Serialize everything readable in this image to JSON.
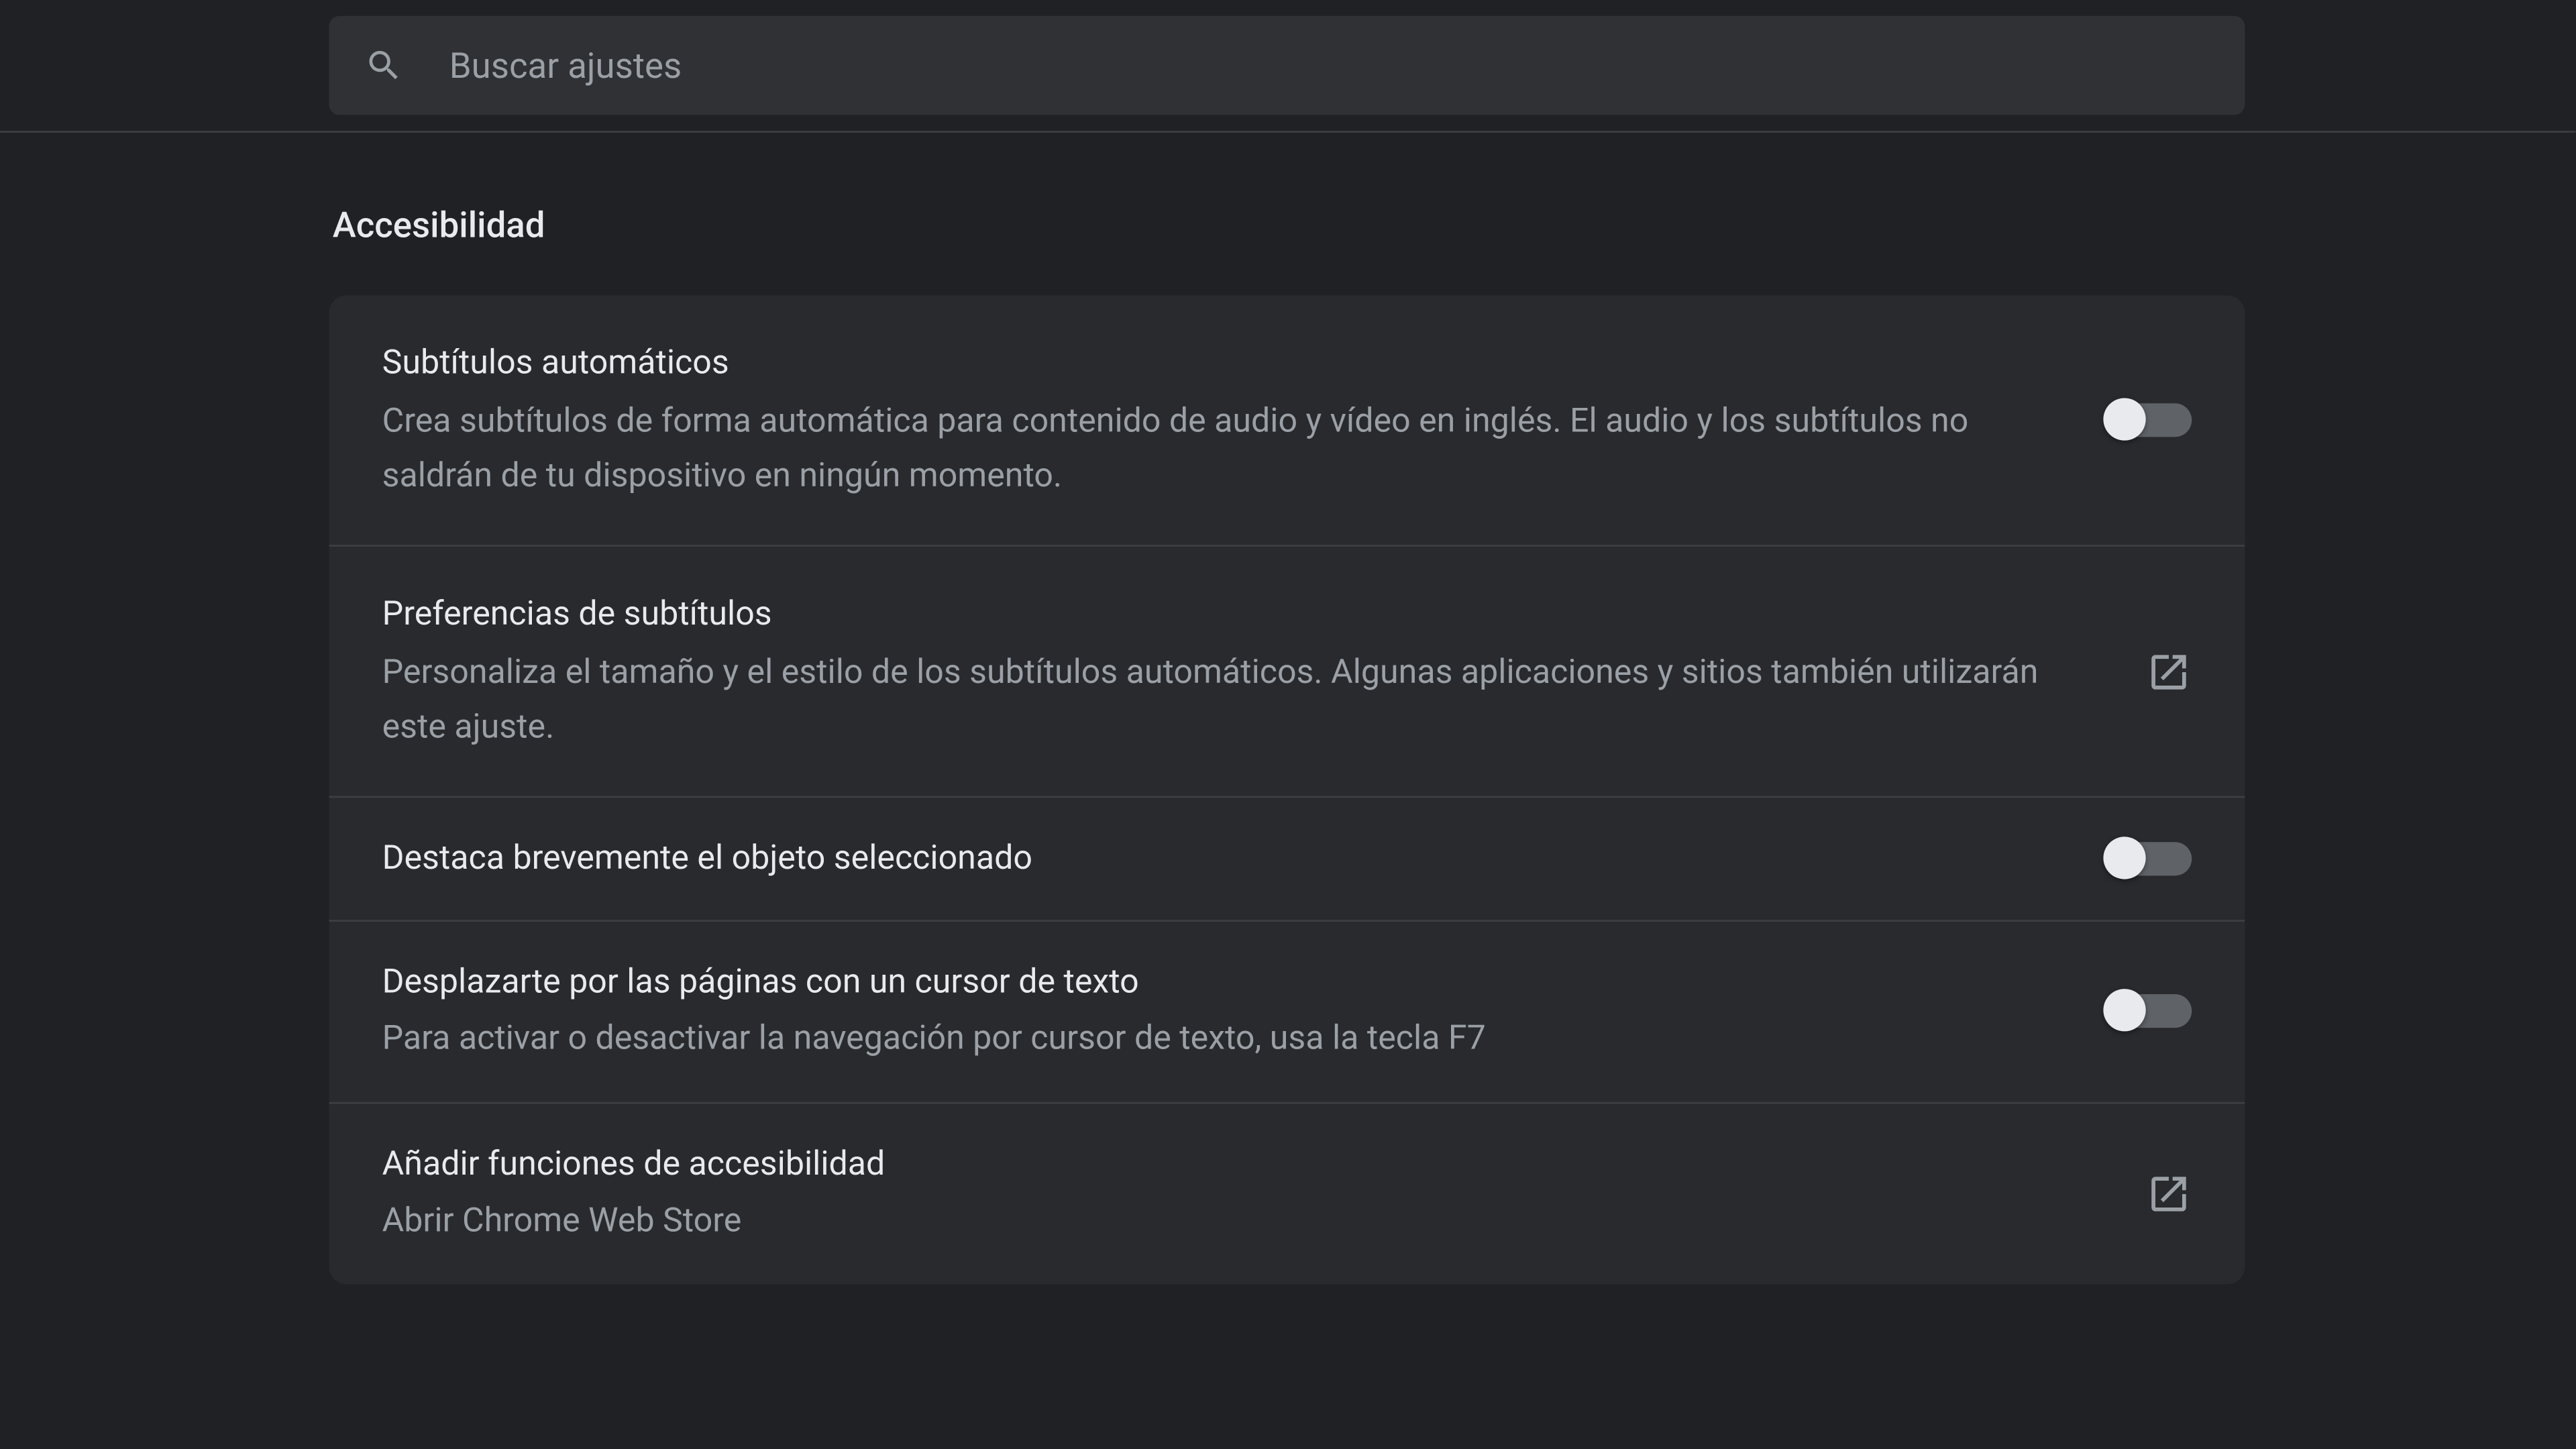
{
  "search": {
    "placeholder": "Buscar ajustes"
  },
  "section": {
    "title": "Accesibilidad"
  },
  "rows": {
    "live_caption": {
      "title": "Subtítulos automáticos",
      "desc": "Crea subtítulos de forma automática para contenido de audio y vídeo en inglés. El audio y los subtítulos no saldrán de tu dispositivo en ningún momento."
    },
    "caption_prefs": {
      "title": "Preferencias de subtítulos",
      "desc": "Personaliza el tamaño y el estilo de los subtítulos automáticos. Algunas aplicaciones y sitios también utilizarán este ajuste."
    },
    "focus_highlight": {
      "title": "Destaca brevemente el objeto seleccionado"
    },
    "caret_browsing": {
      "title": "Desplazarte por las páginas con un cursor de texto",
      "desc": "Para activar o desactivar la navegación por cursor de texto, usa la tecla F7"
    },
    "add_features": {
      "title": "Añadir funciones de accesibilidad",
      "desc": "Abrir Chrome Web Store"
    }
  }
}
